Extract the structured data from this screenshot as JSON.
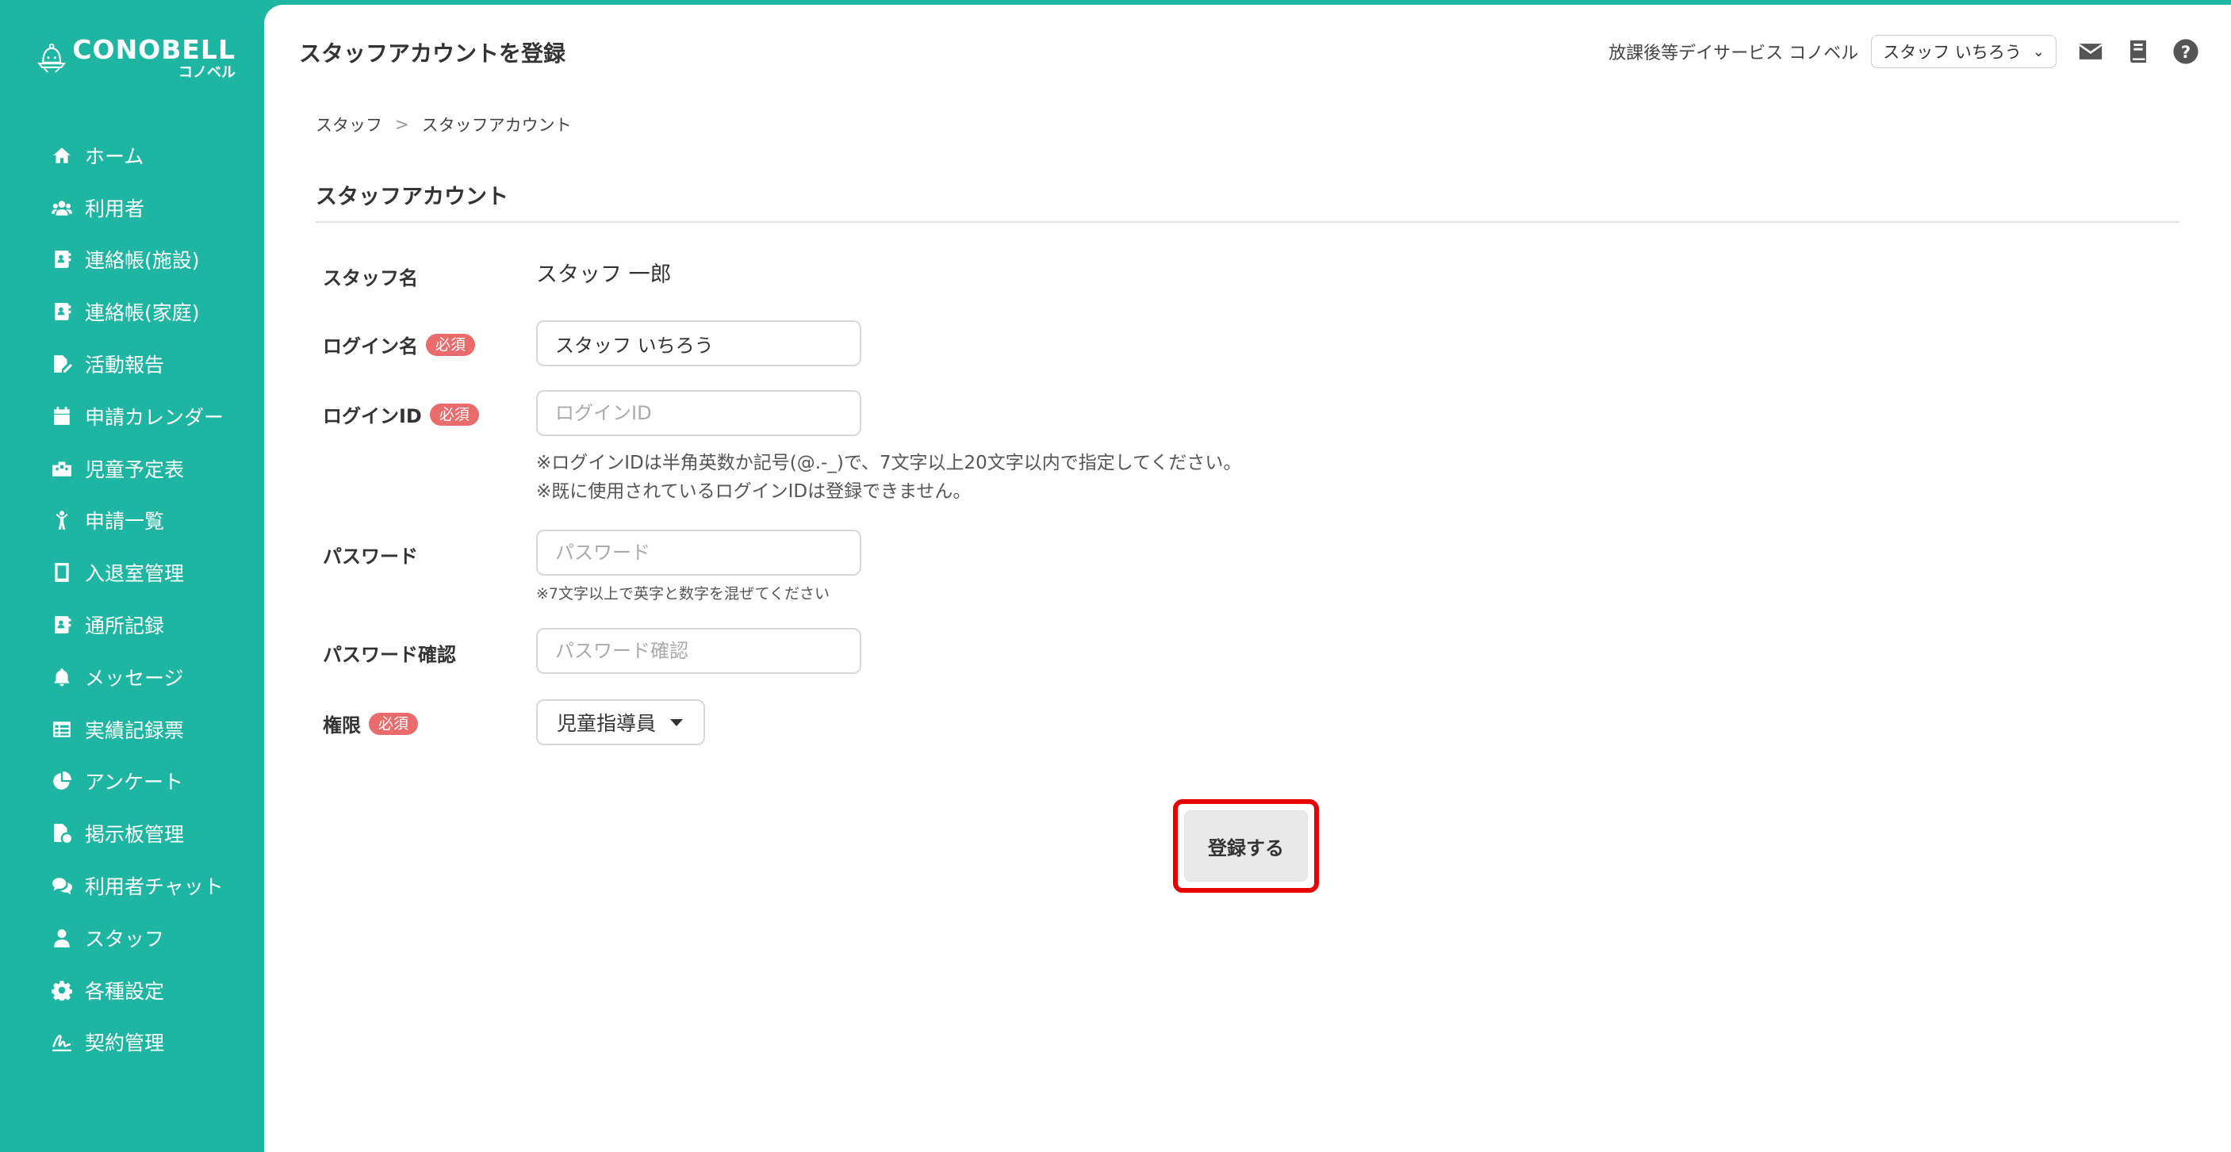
{
  "brand": {
    "name": "CONOBELL",
    "sub": "コノベル"
  },
  "header": {
    "title": "スタッフアカウントを登録",
    "facility": "放課後等デイサービス コノベル",
    "user": "スタッフ いちろう"
  },
  "sidebar": {
    "items": [
      {
        "label": "ホーム",
        "icon": "home-icon"
      },
      {
        "label": "利用者",
        "icon": "users-icon"
      },
      {
        "label": "連絡帳(施設)",
        "icon": "contact-book-icon"
      },
      {
        "label": "連絡帳(家庭)",
        "icon": "contact-book-icon"
      },
      {
        "label": "活動報告",
        "icon": "report-edit-icon"
      },
      {
        "label": "申請カレンダー",
        "icon": "calendar-icon"
      },
      {
        "label": "児童予定表",
        "icon": "schedule-icon"
      },
      {
        "label": "申請一覧",
        "icon": "child-icon"
      },
      {
        "label": "入退室管理",
        "icon": "tablet-icon"
      },
      {
        "label": "通所記録",
        "icon": "record-icon"
      },
      {
        "label": "メッセージ",
        "icon": "bell-icon"
      },
      {
        "label": "実績記録票",
        "icon": "table-icon"
      },
      {
        "label": "アンケート",
        "icon": "pie-chart-icon"
      },
      {
        "label": "掲示板管理",
        "icon": "board-icon"
      },
      {
        "label": "利用者チャット",
        "icon": "chat-icon"
      },
      {
        "label": "スタッフ",
        "icon": "staff-icon"
      },
      {
        "label": "各種設定",
        "icon": "gear-icon"
      },
      {
        "label": "契約管理",
        "icon": "signature-icon"
      }
    ]
  },
  "breadcrumb": [
    "スタッフ",
    "スタッフアカウント"
  ],
  "section_title": "スタッフアカウント",
  "form": {
    "staff_name_label": "スタッフ名",
    "staff_name_value": "スタッフ 一郎",
    "login_name_label": "ログイン名",
    "login_name_value": "スタッフ いちろう",
    "required_badge": "必須",
    "login_id_label": "ログインID",
    "login_id_placeholder": "ログインID",
    "login_id_hint1": "※ログインIDは半角英数か記号(@.-_)で、7文字以上20文字以内で指定してください。",
    "login_id_hint2": "※既に使用されているログインIDは登録できません。",
    "password_label": "パスワード",
    "password_placeholder": "パスワード",
    "password_hint": "※7文字以上で英字と数字を混ぜてください",
    "password_confirm_label": "パスワード確認",
    "password_confirm_placeholder": "パスワード確認",
    "role_label": "権限",
    "role_value": "児童指導員",
    "submit_label": "登録する"
  },
  "colors": {
    "accent": "#1fb5a3",
    "required": "#ea6b6b",
    "highlight": "#e60000"
  }
}
